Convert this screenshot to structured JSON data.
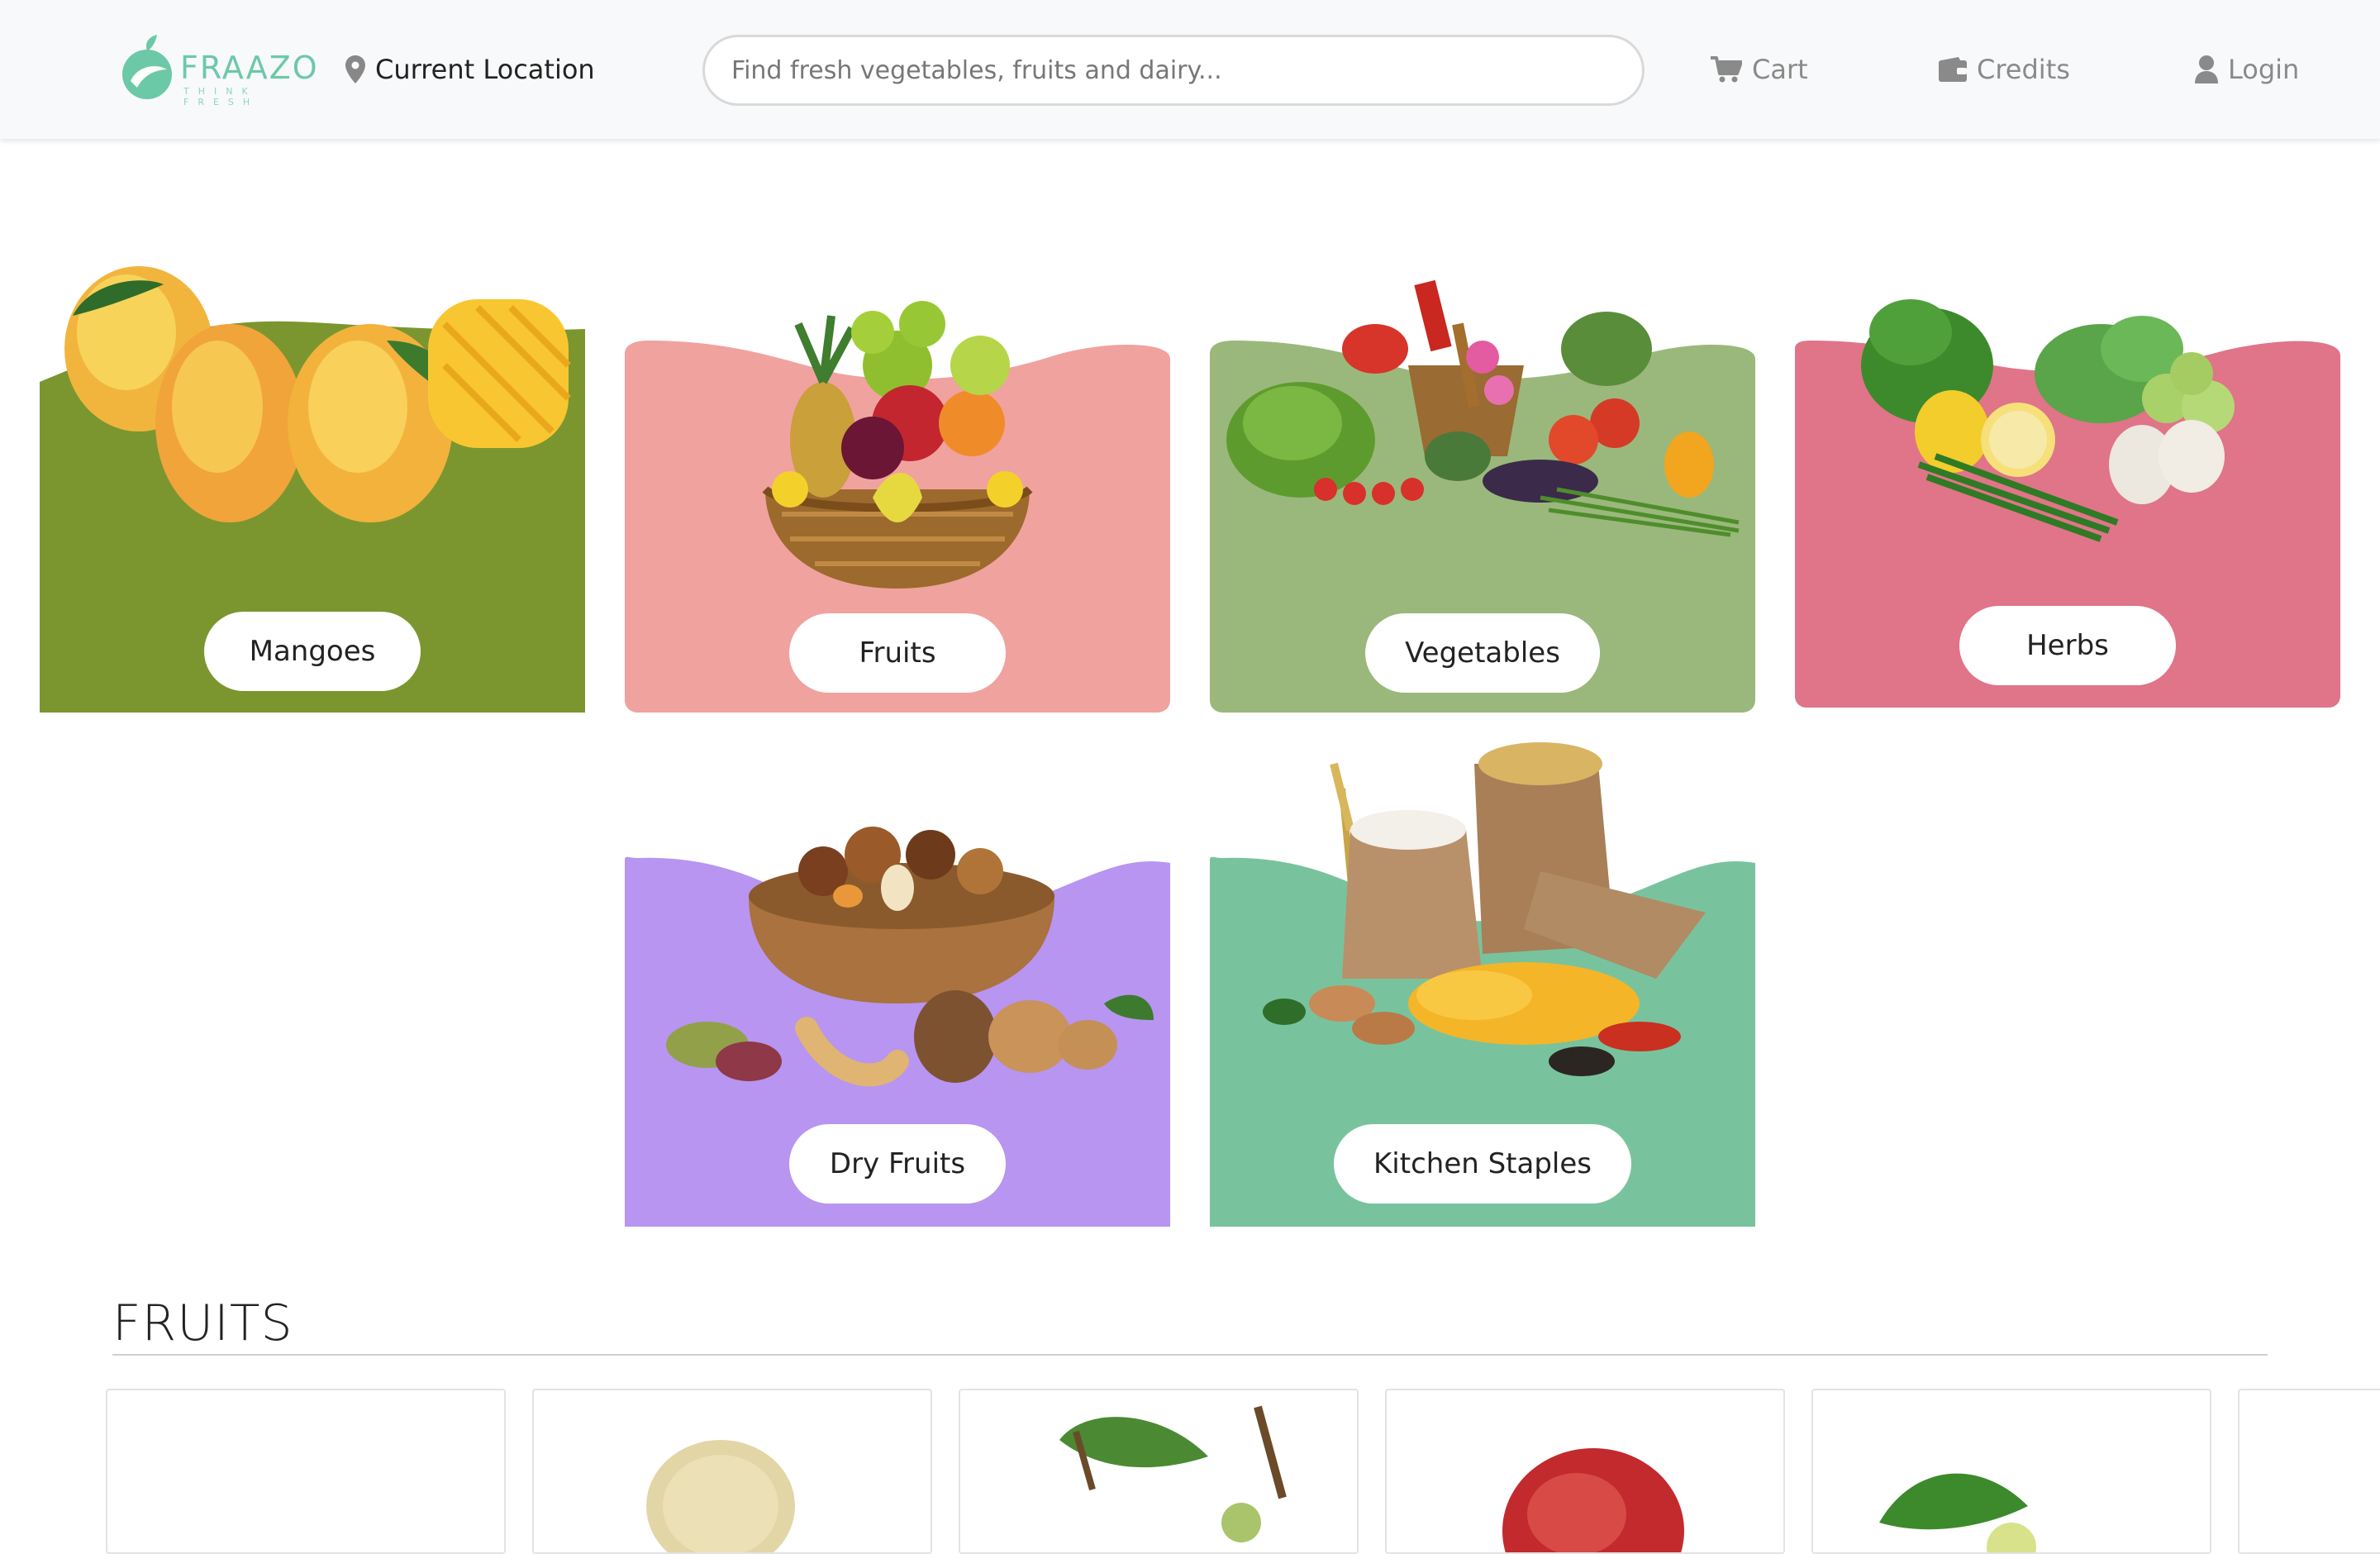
{
  "header": {
    "logo_text": "FRAAZO",
    "logo_tagline": "THINK FRESH",
    "location_label": "Current Location",
    "search_placeholder": "Find fresh vegetables, fruits and dairy...",
    "nav": {
      "cart": "Cart",
      "credits": "Credits",
      "login": "Login"
    }
  },
  "categories": [
    {
      "label": "Mangoes",
      "color": "#7b962f"
    },
    {
      "label": "Fruits",
      "color": "#f0a29f"
    },
    {
      "label": "Vegetables",
      "color": "#9ab87c"
    },
    {
      "label": "Herbs",
      "color": "#e07488"
    },
    {
      "label": "Dry Fruits",
      "color": "#b795f1"
    },
    {
      "label": "Kitchen Staples",
      "color": "#78c39e"
    }
  ],
  "section": {
    "title": "FRUITS"
  },
  "colors": {
    "brand": "#6cc9a8",
    "header_bg": "#f8f9fa",
    "nav_text": "#8a8a8a"
  },
  "icons": {
    "location": "map-pin-icon",
    "cart": "cart-icon",
    "credits": "wallet-icon",
    "login": "user-icon"
  }
}
